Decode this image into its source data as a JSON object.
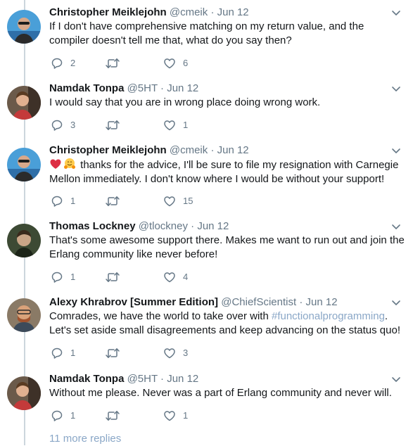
{
  "tweets": [
    {
      "name": "Christopher Meiklejohn",
      "handle": "@cmeik",
      "sep": "·",
      "time": "Jun 12",
      "text": "If I don't have comprehensive matching on my return value, and the compiler doesn't tell me that, what do you say then?",
      "replies": "2",
      "retweets": "",
      "likes": "6"
    },
    {
      "name": "Namdak Tonpa",
      "handle": "@5HT",
      "sep": "·",
      "time": "Jun 12",
      "text": "I would say that you are in wrong place doing wrong work.",
      "replies": "3",
      "retweets": "",
      "likes": "1"
    },
    {
      "name": "Christopher Meiklejohn",
      "handle": "@cmeik",
      "sep": "·",
      "time": "Jun 12",
      "text": "thanks for the advice, I'll be sure to file my resignation with Carnegie Mellon immediately.  I don't know where I would be without your support!",
      "replies": "1",
      "retweets": "",
      "likes": "15"
    },
    {
      "name": "Thomas Lockney",
      "handle": "@tlockney",
      "sep": "·",
      "time": "Jun 12",
      "text": "That's some awesome support there. Makes me want to run out and join the Erlang community like never before!",
      "replies": "1",
      "retweets": "",
      "likes": "4"
    },
    {
      "name": "Alexy Khrabrov [Summer Edition]",
      "handle": "@ChiefScientist",
      "sep": "·",
      "time": "Jun 12",
      "text_before": "Comrades, we have the world to take over with ",
      "hashtag": "#functionalprogramming",
      "text_after": ". Let's set aside small disagreements and keep advancing on the status quo!",
      "replies": "1",
      "retweets": "",
      "likes": "3"
    },
    {
      "name": "Namdak Tonpa",
      "handle": "@5HT",
      "sep": "·",
      "time": "Jun 12",
      "text": "Without me please. Never was a part of Erlang community and never will.",
      "replies": "1",
      "retweets": "",
      "likes": "1"
    }
  ],
  "more_replies": "11 more replies",
  "icons": {
    "reply": "reply-icon",
    "retweet": "retweet-icon",
    "like": "heart-icon",
    "menu": "chevron-down-icon",
    "emoji_1": "red-heart-emoji",
    "emoji_2": "hugging-face-emoji"
  },
  "colors": {
    "text": "#14171a",
    "secondary": "#657786",
    "link": "#8aa7c7",
    "thread": "#ccd6dd"
  }
}
